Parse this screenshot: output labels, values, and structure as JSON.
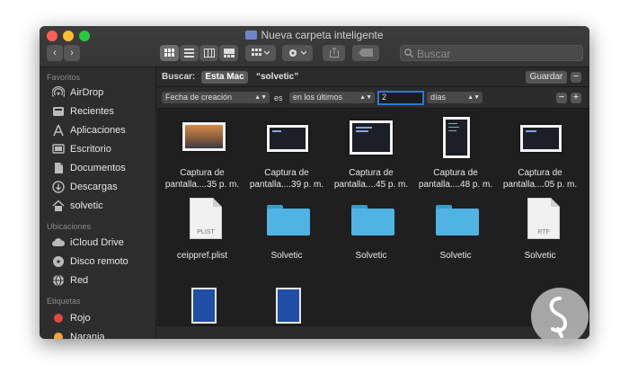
{
  "window": {
    "title": "Nueva carpeta inteligente"
  },
  "toolbar": {
    "search_placeholder": "Buscar"
  },
  "sidebar": {
    "favorites_title": "Favoritos",
    "favorites": [
      {
        "label": "AirDrop",
        "icon": "airdrop-icon"
      },
      {
        "label": "Recientes",
        "icon": "clock-icon"
      },
      {
        "label": "Aplicaciones",
        "icon": "apps-icon"
      },
      {
        "label": "Escritorio",
        "icon": "desktop-icon"
      },
      {
        "label": "Documentos",
        "icon": "document-icon"
      },
      {
        "label": "Descargas",
        "icon": "download-icon"
      },
      {
        "label": "solvetic",
        "icon": "home-icon"
      }
    ],
    "locations_title": "Ubicaciones",
    "locations": [
      {
        "label": "iCloud Drive",
        "icon": "cloud-icon"
      },
      {
        "label": "Disco remoto",
        "icon": "disc-icon"
      },
      {
        "label": "Red",
        "icon": "network-icon"
      }
    ],
    "tags_title": "Etiquetas",
    "tags": [
      {
        "label": "Rojo",
        "color": "#e5483f"
      },
      {
        "label": "Naranja",
        "color": "#f2a33a"
      }
    ]
  },
  "search": {
    "label": "Buscar:",
    "scope": "Esta Mac",
    "query": "“solvetic”",
    "save_label": "Guardar"
  },
  "criteria": {
    "attribute": "Fecha de creación",
    "operator_label": "es",
    "operator": "en los últimos",
    "value": "2",
    "unit": "días"
  },
  "files": [
    {
      "name": "Captura de pantalla....35 p. m.",
      "kind": "screenshot-wide"
    },
    {
      "name": "Captura de pantalla....39 p. m.",
      "kind": "screenshot-dark"
    },
    {
      "name": "Captura de pantalla....45 p. m.",
      "kind": "screenshot-dark"
    },
    {
      "name": "Captura de pantalla....48 p. m.",
      "kind": "screenshot-tall"
    },
    {
      "name": "Captura de pantalla....05 p. m.",
      "kind": "screenshot-dark"
    },
    {
      "name": "ceippref.plist",
      "kind": "document",
      "ext": "PLIST"
    },
    {
      "name": "Solvetic",
      "kind": "folder"
    },
    {
      "name": "Solvetic",
      "kind": "folder"
    },
    {
      "name": "Solvetic",
      "kind": "folder"
    },
    {
      "name": "Solvetic",
      "kind": "document",
      "ext": "RTF"
    }
  ],
  "colors": {
    "accent": "#2f78d6",
    "folder": "#4fb3e3"
  }
}
